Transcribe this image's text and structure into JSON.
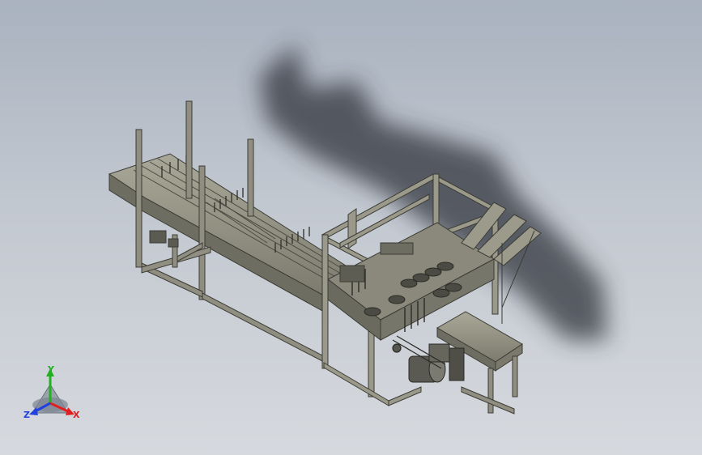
{
  "triad": {
    "x_label": "X",
    "y_label": "Y",
    "z_label": "Z",
    "x_color": "#e02020",
    "y_color": "#20b020",
    "z_color": "#2040e0"
  },
  "colors": {
    "frame": "#6f6f64",
    "frame_dark": "#3c3c36",
    "body": "#8d8c7e",
    "body_light": "#a8a797",
    "shadow": "#2a2f36"
  }
}
